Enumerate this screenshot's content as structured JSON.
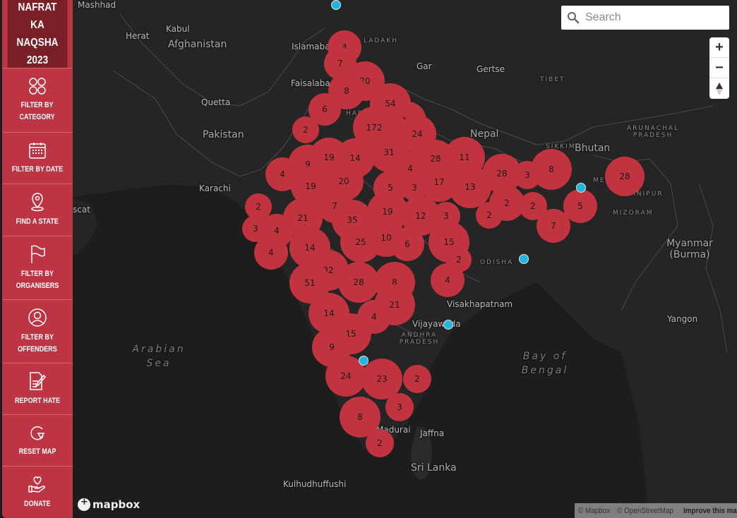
{
  "app": {
    "title": "NAFRAT KA NAQSHA 2023"
  },
  "sidebar": {
    "brand": [
      "NAFRAT KA",
      "NAQSHA",
      "2023"
    ],
    "items": [
      {
        "id": "category",
        "label": [
          "FILTER BY",
          "CATEGORY"
        ],
        "icon": "grid-circles-icon"
      },
      {
        "id": "date",
        "label": [
          "FILTER BY DATE"
        ],
        "icon": "calendar-icon"
      },
      {
        "id": "state",
        "label": [
          "FIND A STATE"
        ],
        "icon": "map-pin-icon"
      },
      {
        "id": "organisers",
        "label": [
          "FILTER BY",
          "ORGANISERS"
        ],
        "icon": "flag-icon"
      },
      {
        "id": "offenders",
        "label": [
          "FILTER BY",
          "OFFENDERS"
        ],
        "icon": "user-circle-icon"
      },
      {
        "id": "report",
        "label": [
          "REPORT HATE"
        ],
        "icon": "document-pen-icon"
      },
      {
        "id": "reset",
        "label": [
          "RESET MAP"
        ],
        "icon": "reset-icon"
      },
      {
        "id": "donate",
        "label": [
          "DONATE"
        ],
        "icon": "hand-heart-icon"
      }
    ]
  },
  "search": {
    "placeholder": "Search",
    "value": ""
  },
  "controls": {
    "zoom_in": "+",
    "zoom_out": "−",
    "compass": "compass-icon"
  },
  "attribution": {
    "mapbox": "© Mapbox",
    "osm": "© OpenStreetMap",
    "improve": "Improve this map",
    "logo": "mapbox"
  },
  "colors": {
    "cluster": "#c1343f",
    "point": "#22b5e0",
    "sidebar": "#bd3545",
    "brand_bg": "#7b1f27"
  },
  "labels": [
    {
      "text": "Mashhad",
      "type": "city"
    },
    {
      "text": "Herat",
      "type": "city"
    },
    {
      "text": "Afghanistan",
      "type": "country"
    },
    {
      "text": "Kabul",
      "type": "city"
    },
    {
      "text": "Islamabad",
      "type": "city"
    },
    {
      "text": "Faisalabad",
      "type": "city"
    },
    {
      "text": "Quetta",
      "type": "city"
    },
    {
      "text": "Pakistan",
      "type": "country"
    },
    {
      "text": "Karachi",
      "type": "city"
    },
    {
      "text": "scat",
      "type": "city"
    },
    {
      "text": "LADAKH",
      "type": "region"
    },
    {
      "text": "Gar",
      "type": "city"
    },
    {
      "text": "Gertse",
      "type": "city"
    },
    {
      "text": "TIBET",
      "type": "region"
    },
    {
      "text": "HARY",
      "type": "region"
    },
    {
      "text": "Nepal",
      "type": "country"
    },
    {
      "text": "SIKKIM",
      "type": "region"
    },
    {
      "text": "Bhutan",
      "type": "country"
    },
    {
      "text": "ARUNACHAL PRADESH",
      "type": "region"
    },
    {
      "text": "MEGHALAYA",
      "type": "region"
    },
    {
      "text": "MANIPUR",
      "type": "region"
    },
    {
      "text": "MIZORAM",
      "type": "region"
    },
    {
      "text": "Myanmar (Burma)",
      "type": "country"
    },
    {
      "text": "ODISHA",
      "type": "region"
    },
    {
      "text": "Visakhapatnam",
      "type": "city"
    },
    {
      "text": "Vijayawada",
      "type": "city"
    },
    {
      "text": "ANDHRA PRADESH",
      "type": "region"
    },
    {
      "text": "Arabian Sea",
      "type": "sea"
    },
    {
      "text": "Bay of Bengal",
      "type": "sea"
    },
    {
      "text": "Yangon",
      "type": "city"
    },
    {
      "text": "Madurai",
      "type": "city"
    },
    {
      "text": "Jaffna",
      "type": "city"
    },
    {
      "text": "Sri Lanka",
      "type": "country"
    },
    {
      "text": "Kulhudhuffushi",
      "type": "city"
    }
  ],
  "clusters": [
    4,
    7,
    20,
    8,
    6,
    54,
    2,
    172,
    13,
    24,
    31,
    28,
    11,
    9,
    19,
    14,
    4,
    4,
    28,
    3,
    8,
    28,
    19,
    20,
    5,
    3,
    17,
    13,
    2,
    7,
    19,
    12,
    3,
    2,
    2,
    2,
    5,
    21,
    35,
    3,
    4,
    7,
    4,
    25,
    10,
    6,
    15,
    14,
    2,
    32,
    51,
    28,
    8,
    4,
    21,
    14,
    4,
    15,
    9,
    24,
    23,
    2,
    3,
    8,
    2
  ],
  "incident_points": 6
}
